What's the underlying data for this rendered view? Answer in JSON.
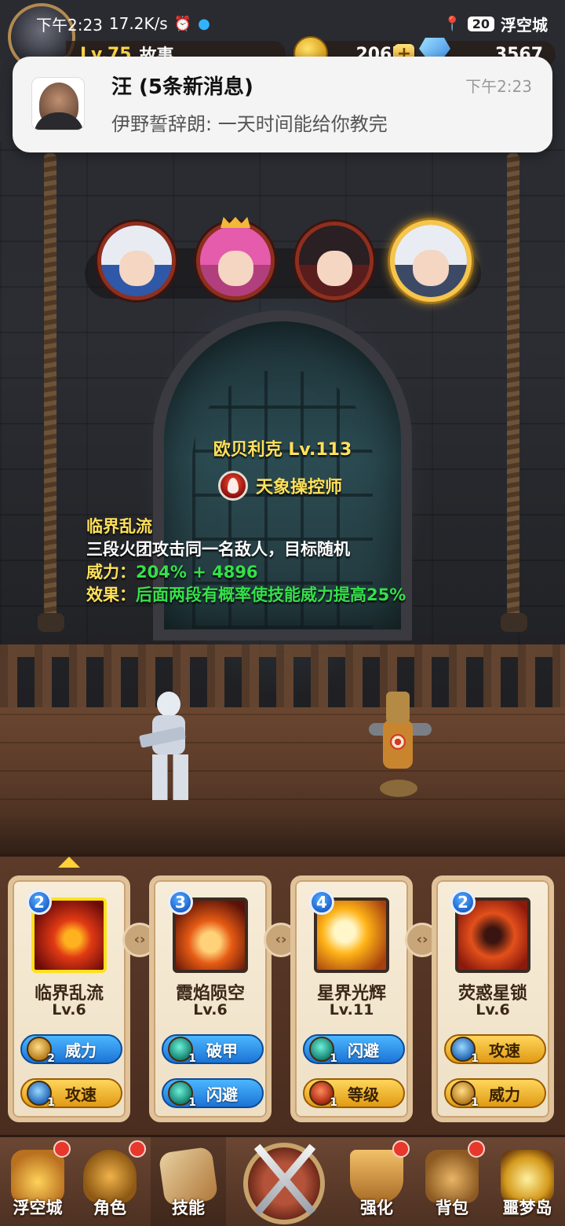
{
  "status_bar": {
    "time": "下午2:23",
    "speed": "17.2K/s",
    "battery": "20",
    "location": "浮空城"
  },
  "player": {
    "level": "Lv.75",
    "name": "故事",
    "gold": "206k",
    "gems": "3567"
  },
  "notification": {
    "title": "汪 (5条新消息)",
    "time": "下午2:23",
    "body": "伊野誓辞朗: 一天时间能给你教完"
  },
  "heroes": [
    "hero-1",
    "hero-2",
    "hero-3",
    "hero-4"
  ],
  "character": {
    "name": "欧贝利克",
    "level": "Lv.113",
    "class": "天象操控师"
  },
  "skill_detail": {
    "name": "临界乱流",
    "description": "三段火团攻击同一名敌人，目标随机",
    "power_label": "威力：",
    "power_value": "204% + 4896",
    "effect_label": "效果：",
    "effect_value": "后面两段有概率使技能威力提高25%"
  },
  "skills": [
    {
      "badge": "2",
      "name": "临界乱流",
      "level": "Lv.6",
      "runes": [
        {
          "label": "威力",
          "count": "2",
          "icon": "fist-rune-icon",
          "style": "blue"
        },
        {
          "label": "攻速",
          "count": "1",
          "icon": "wind-rune-icon",
          "style": "gold"
        }
      ]
    },
    {
      "badge": "3",
      "name": "霞焰陨空",
      "level": "Lv.6",
      "runes": [
        {
          "label": "破甲",
          "count": "1",
          "icon": "swirl-rune-icon",
          "style": "blue"
        },
        {
          "label": "闪避",
          "count": "1",
          "icon": "swirl-rune-icon",
          "style": "blue"
        }
      ]
    },
    {
      "badge": "4",
      "name": "星界光辉",
      "level": "Lv.11",
      "runes": [
        {
          "label": "闪避",
          "count": "1",
          "icon": "swirl-rune-icon",
          "style": "blue"
        },
        {
          "label": "等级",
          "count": "1",
          "icon": "chevron-rune-icon",
          "style": "gold"
        }
      ]
    },
    {
      "badge": "2",
      "name": "荧惑星锁",
      "level": "Lv.6",
      "runes": [
        {
          "label": "攻速",
          "count": "1",
          "icon": "wind-rune-icon",
          "style": "gold"
        },
        {
          "label": "威力",
          "count": "1",
          "icon": "fist-rune-icon",
          "style": "gold"
        }
      ]
    }
  ],
  "bottom_nav": [
    {
      "label": "浮空城",
      "badge": true
    },
    {
      "label": "角色",
      "badge": true
    },
    {
      "label": "技能",
      "badge": false
    },
    {
      "label": "",
      "badge": false
    },
    {
      "label": "强化",
      "badge": true
    },
    {
      "label": "背包",
      "badge": true
    },
    {
      "label": "噩梦岛",
      "badge": false
    }
  ],
  "colors": {
    "gold_text": "#ffe15a",
    "green_text": "#35e04a",
    "rune_blue": "#1c73d6",
    "rune_gold": "#e09a14",
    "notification_bg": "#f4f4f4"
  }
}
